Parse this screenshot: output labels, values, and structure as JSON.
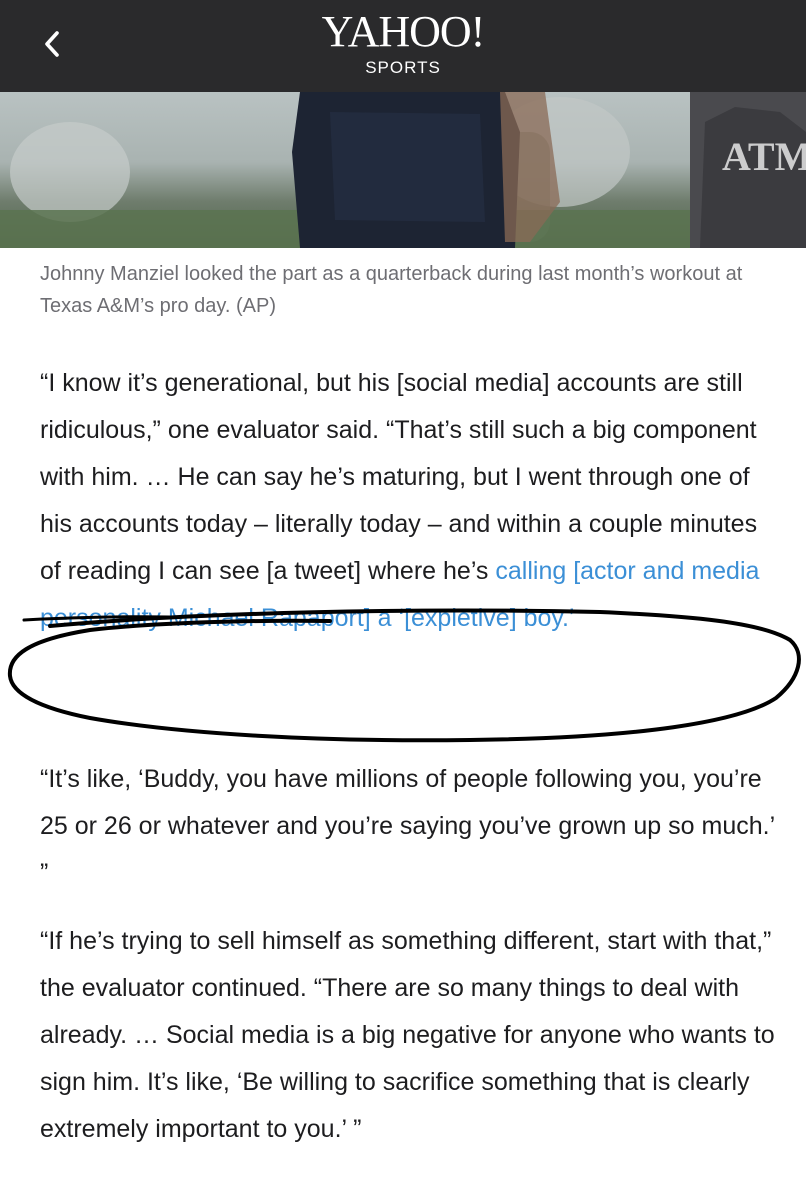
{
  "header": {
    "back_icon": "chevron-left-icon",
    "logo": "YAHOO!",
    "section": "SPORTS",
    "background": "#2a2a2c"
  },
  "caption": "Johnny Manziel looked the part as a quarterback during last month’s workout at Texas A&M’s pro day. (AP)",
  "paragraphs": {
    "p1_text": "“I know it’s generational, but his [social media] accounts are still ridiculous,” one evaluator said. “That’s still such a big component with him. … He can say he’s maturing, but I went through one of his accounts today – literally today – and within a couple minutes of reading I can see [a tweet] where he’s ",
    "p1_link": "calling [actor and media personality Michael Rapaport] a ‘[expletive] boy.’",
    "p2": "“It’s like, ‘Buddy, you have millions of people following you, you’re 25 or 26 or whatever and you’re saying you’ve grown up so much.’ ”",
    "p3": "“If he’s trying to sell himself as something different, start with that,” the evaluator continued. “There are so many things to deal with already. … Social media is a big negative for anyone who wants to sign him. It’s like, ‘Be willing to sacrifice something that is clearly extremely important to you.’ ”"
  },
  "colors": {
    "link": "#3b8fd6",
    "caption": "#6e6e73",
    "text": "#1d1d1f",
    "annotation": "#000000"
  }
}
